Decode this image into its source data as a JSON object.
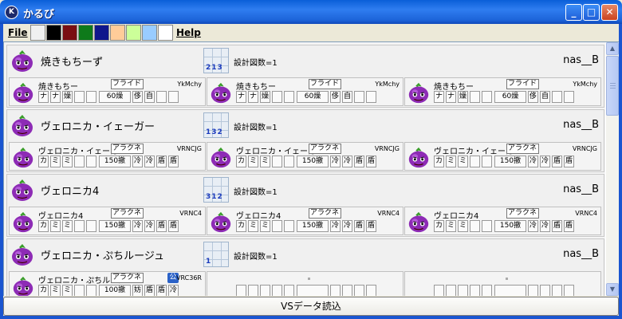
{
  "window": {
    "title": "かるび",
    "icon": "app-logo-icon",
    "controls": [
      "minimize-icon",
      "maximize-icon",
      "close-icon"
    ]
  },
  "menubar": {
    "file_label": "File",
    "help_label": "Help",
    "swatches": [
      "#f0f0f0",
      "#000000",
      "#7a0e12",
      "#0e7a1a",
      "#10168c",
      "#ffcc99",
      "#ccff99",
      "#99ccff",
      "#ffffff"
    ]
  },
  "blocks": [
    {
      "name": "焼きもちーず",
      "design_nums": "213",
      "design_count": "設計図数=1",
      "author": "nas__B",
      "units": [
        {
          "name": "焼きもちー",
          "type": "フライド",
          "code": "YkMchy",
          "kou": "",
          "cells": [
            "ナ",
            "ナ",
            "燥",
            "",
            "",
            "60燥",
            "侈",
            "自",
            "",
            ""
          ]
        },
        {
          "name": "焼きもちー",
          "type": "フライド",
          "code": "YkMchy",
          "kou": "",
          "cells": [
            "ナ",
            "ナ",
            "燥",
            "",
            "",
            "60燥",
            "侈",
            "自",
            "",
            ""
          ]
        },
        {
          "name": "焼きもちー",
          "type": "フライド",
          "code": "YkMchy",
          "kou": "",
          "cells": [
            "ナ",
            "ナ",
            "燥",
            "",
            "",
            "60燥",
            "侈",
            "自",
            "",
            ""
          ]
        }
      ]
    },
    {
      "name": "ヴェロニカ・イェーガー",
      "design_nums": "132",
      "design_count": "設計図数=1",
      "author": "nas__B",
      "units": [
        {
          "name": "ヴェロニカ・イェーガー",
          "type": "アラクネー",
          "code": "VRNCJG",
          "kou": "",
          "cells": [
            "カ",
            "ミ",
            "ミ",
            "",
            "",
            "150撤",
            "冷",
            "冷",
            "盾",
            "盾"
          ]
        },
        {
          "name": "ヴェロニカ・イェーガー",
          "type": "アラクネー",
          "code": "VRNCJG",
          "kou": "",
          "cells": [
            "カ",
            "ミ",
            "ミ",
            "",
            "",
            "150撤",
            "冷",
            "冷",
            "盾",
            "盾"
          ]
        },
        {
          "name": "ヴェロニカ・イェーガー",
          "type": "アラクネー",
          "code": "VRNCJG",
          "kou": "",
          "cells": [
            "カ",
            "ミ",
            "ミ",
            "",
            "",
            "150撤",
            "冷",
            "冷",
            "盾",
            "盾"
          ]
        }
      ]
    },
    {
      "name": "ヴェロニカ4",
      "design_nums": "312",
      "design_count": "設計図数=1",
      "author": "nas__B",
      "units": [
        {
          "name": "ヴェロニカ4",
          "type": "アラクネー",
          "code": "VRNC4",
          "kou": "",
          "cells": [
            "カ",
            "ミ",
            "ミ",
            "",
            "",
            "150撤",
            "冷",
            "冷",
            "盾",
            "盾"
          ]
        },
        {
          "name": "ヴェロニカ4",
          "type": "アラクネー",
          "code": "VRNC4",
          "kou": "",
          "cells": [
            "カ",
            "ミ",
            "ミ",
            "",
            "",
            "150撤",
            "冷",
            "冷",
            "盾",
            "盾"
          ]
        },
        {
          "name": "ヴェロニカ4",
          "type": "アラクネー",
          "code": "VRNC4",
          "kou": "",
          "cells": [
            "カ",
            "ミ",
            "ミ",
            "",
            "",
            "150撤",
            "冷",
            "冷",
            "盾",
            "盾"
          ]
        }
      ]
    },
    {
      "name": "ヴェロニカ・ぷちルージュ",
      "design_nums": "1",
      "design_count": "設計図数=1",
      "author": "nas__B",
      "units": [
        {
          "name": "ヴェロニカ・ぷちルージュ",
          "type": "アラクネー",
          "code": "VRC36R",
          "kou": "公",
          "cells": [
            "カ",
            "ミ",
            "ミ",
            "",
            "",
            "100撤",
            "妨",
            "盾",
            "盾",
            "冷"
          ]
        },
        {
          "name": "",
          "type": "",
          "code": "",
          "kou": "",
          "cells": [
            "",
            "",
            "",
            "",
            "",
            "",
            "",
            "",
            "",
            ""
          ]
        },
        {
          "name": "",
          "type": "",
          "code": "",
          "kou": "",
          "cells": [
            "",
            "",
            "",
            "",
            "",
            "",
            "",
            "",
            "",
            ""
          ]
        }
      ]
    }
  ],
  "bottom_button": "VSデータ読込"
}
